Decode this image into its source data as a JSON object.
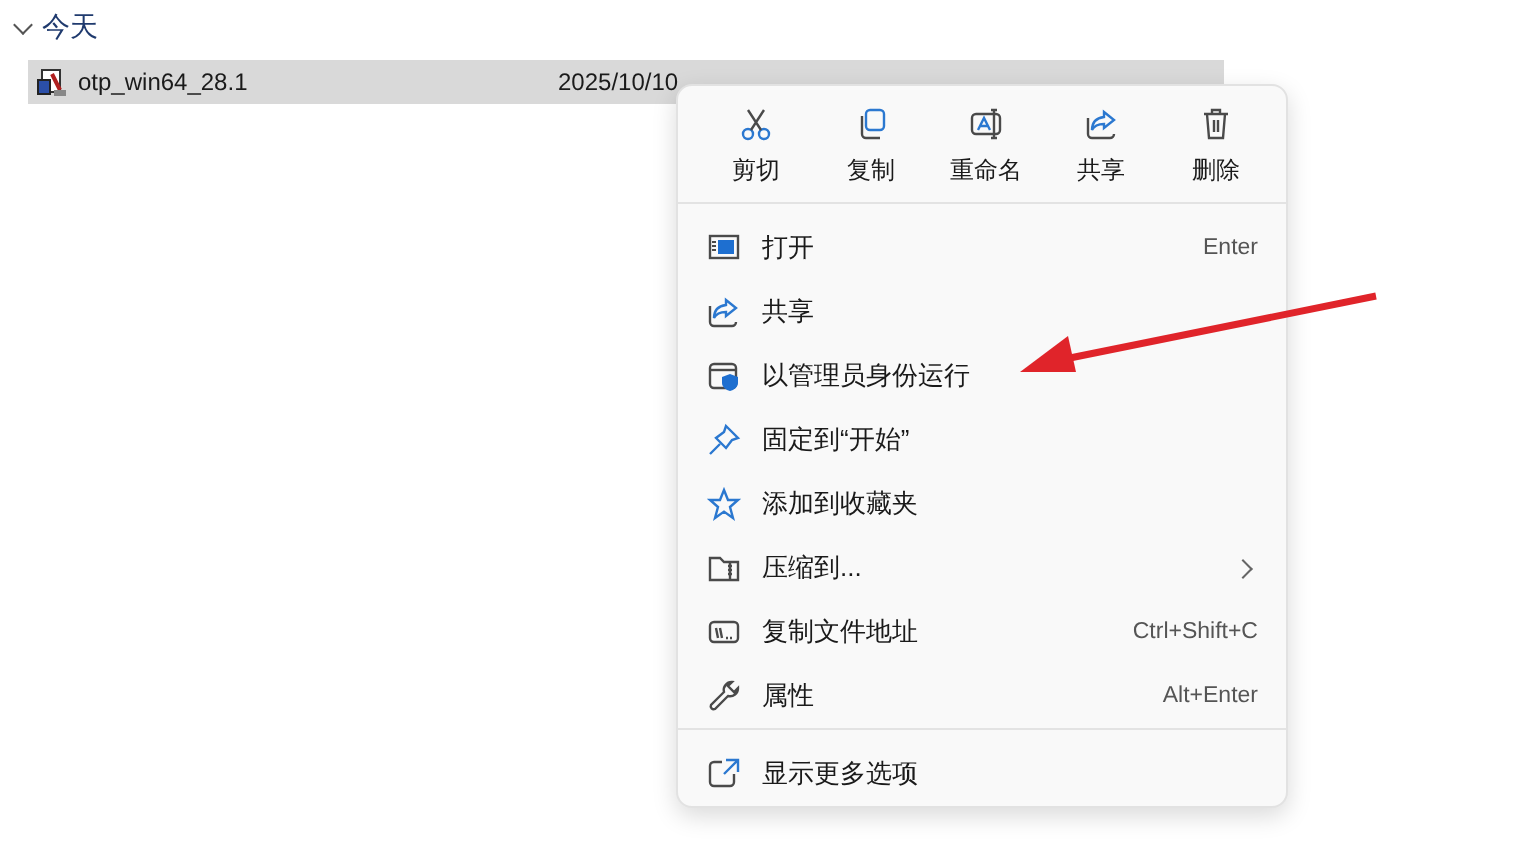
{
  "group": {
    "title": "今天",
    "expanded": true
  },
  "file": {
    "name": "otp_win64_28.1",
    "modified": "2025/10/10",
    "selected": true
  },
  "context_menu": {
    "quick_actions": [
      {
        "kind": "cut",
        "label": "剪切"
      },
      {
        "kind": "copy",
        "label": "复制"
      },
      {
        "kind": "rename",
        "label": "重命名"
      },
      {
        "kind": "share",
        "label": "共享"
      },
      {
        "kind": "delete",
        "label": "删除"
      }
    ],
    "items": [
      {
        "kind": "open",
        "label": "打开",
        "shortcut": "Enter"
      },
      {
        "kind": "share",
        "label": "共享"
      },
      {
        "kind": "admin",
        "label": "以管理员身份运行"
      },
      {
        "kind": "pin",
        "label": "固定到“开始”"
      },
      {
        "kind": "star",
        "label": "添加到收藏夹"
      },
      {
        "kind": "zip",
        "label": "压缩到...",
        "submenu": true
      },
      {
        "kind": "path",
        "label": "复制文件地址",
        "shortcut": "Ctrl+Shift+C"
      },
      {
        "kind": "props",
        "label": "属性",
        "shortcut": "Alt+Enter"
      }
    ],
    "footer": {
      "kind": "more",
      "label": "显示更多选项"
    }
  }
}
